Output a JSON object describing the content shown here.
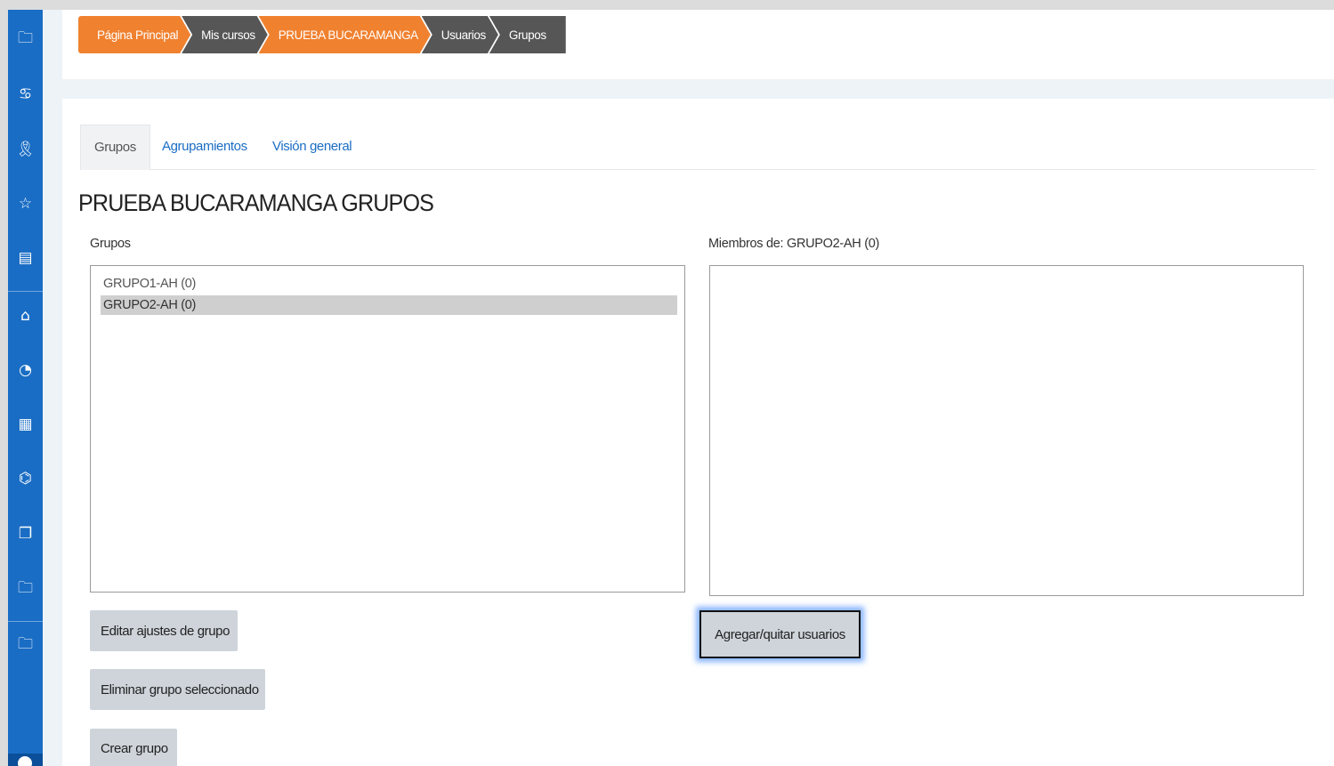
{
  "breadcrumb": [
    {
      "label": "Página Principal",
      "color": "#f0812f"
    },
    {
      "label": "Mis cursos",
      "color": "#565656"
    },
    {
      "label": "PRUEBA BUCARAMANGA",
      "color": "#f0812f"
    },
    {
      "label": "Usuarios",
      "color": "#565656"
    },
    {
      "label": "Grupos",
      "color": "#565656"
    }
  ],
  "tabs": {
    "grupos": "Grupos",
    "agrupamientos": "Agrupamientos",
    "vision_general": "Visión general"
  },
  "page_title": "PRUEBA BUCARAMANGA GRUPOS",
  "groups": {
    "label": "Grupos",
    "items": [
      {
        "label": "GRUPO1-AH (0)",
        "selected": false
      },
      {
        "label": "GRUPO2-AH (0)",
        "selected": true
      }
    ]
  },
  "members": {
    "label": "Miembros de: GRUPO2-AH (0)",
    "items": []
  },
  "buttons": {
    "edit": "Editar ajustes de grupo",
    "delete": "Eliminar grupo seleccionado",
    "create": "Crear grupo",
    "add_remove": "Agregar/quitar usuarios"
  },
  "sidebar_icons": [
    "folder-icon",
    "participants-icon",
    "badges-icon",
    "competencies-icon",
    "grades-icon",
    "home-icon",
    "dashboard-icon",
    "calendar-icon",
    "private-files-icon",
    "content-bank-icon",
    "folder-icon",
    "folder-icon"
  ],
  "colors": {
    "sidebar": "#1a6dc4",
    "accent_orange": "#f0812f",
    "dark_crumb": "#565656",
    "link": "#1a6dc4"
  }
}
